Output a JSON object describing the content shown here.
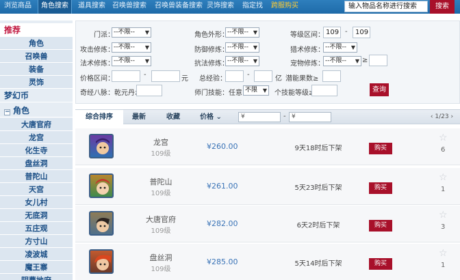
{
  "topnav": {
    "tabs": [
      "浏览商品",
      "角色搜索",
      "道具搜索",
      "召唤兽搜索",
      "召唤兽装备搜索",
      "灵饰搜索",
      "指定找",
      "跨服购买"
    ],
    "search_placeholder": "输入物品名称进行搜索",
    "search_button": "搜索"
  },
  "sidebar": {
    "recommend": "推荐",
    "recommend_items": [
      "角色",
      "召唤兽",
      "装备",
      "灵饰"
    ],
    "currency": "梦幻币",
    "role_header": "角色",
    "schools": [
      "大唐官府",
      "龙宫",
      "化生寺",
      "盘丝洞",
      "普陀山",
      "天宫",
      "女儿村",
      "无底洞",
      "五庄观",
      "方寸山",
      "凌波城",
      "魔王寨",
      "阴曹地府"
    ]
  },
  "filters": {
    "school_label": "门派：",
    "school_value": "--不限--",
    "appearance_label": "角色外形：",
    "appearance_value": "--不限--",
    "level_label": "等级区间：",
    "level_min": "109",
    "level_sep": "-",
    "level_max": "109",
    "attack_label": "攻击修炼：",
    "attack_value": "--不限--",
    "defense_label": "防御修炼：",
    "defense_value": "--不限--",
    "hunt_label": "猎术修炼：",
    "hunt_value": "--不限--",
    "magic_label": "法术修炼：",
    "magic_value": "--不限--",
    "resist_label": "抗法修炼：",
    "resist_value": "--不限--",
    "pet_label": "宠物修炼：",
    "pet_value": "--不限--",
    "gte": "≥",
    "price_label": "价格区间：",
    "price_sep": "-",
    "price_unit": "元",
    "exp_label": "总经验：",
    "exp_sep": "-",
    "exp_unit": "亿",
    "potential_label": "潜能果数≥",
    "meridian_label": "奇经八脉：乾元丹≥",
    "master_label": "师门技能：任意",
    "master_value": "不限",
    "skill_label": "个技能等级≥",
    "query_button": "查询"
  },
  "sortbar": {
    "tabs": [
      "综合排序",
      "最新",
      "收藏",
      "价格"
    ],
    "price_arrow": "⌄",
    "yen1": "¥",
    "yen2": "¥",
    "range_sep": "-",
    "pager": "1/23"
  },
  "listings": [
    {
      "name": "龙宫",
      "level": "109级",
      "price": "¥260.00",
      "time": "9天18时后下架",
      "buy": "购买",
      "favorites": "6"
    },
    {
      "name": "普陀山",
      "level": "109级",
      "price": "¥261.00",
      "time": "5天23时后下架",
      "buy": "购买",
      "favorites": "1"
    },
    {
      "name": "大唐官府",
      "level": "109级",
      "price": "¥282.00",
      "time": "6天2时后下架",
      "buy": "购买",
      "favorites": "3"
    },
    {
      "name": "盘丝洞",
      "level": "109级",
      "price": "¥285.00",
      "time": "5天14时后下架",
      "buy": "购买",
      "favorites": "1"
    }
  ],
  "colors": {
    "nav_blue": "#1e6aa8",
    "buy_red": "#a8102a",
    "price_blue": "#3872b6",
    "sidebar_bg": "#e6edf4"
  }
}
